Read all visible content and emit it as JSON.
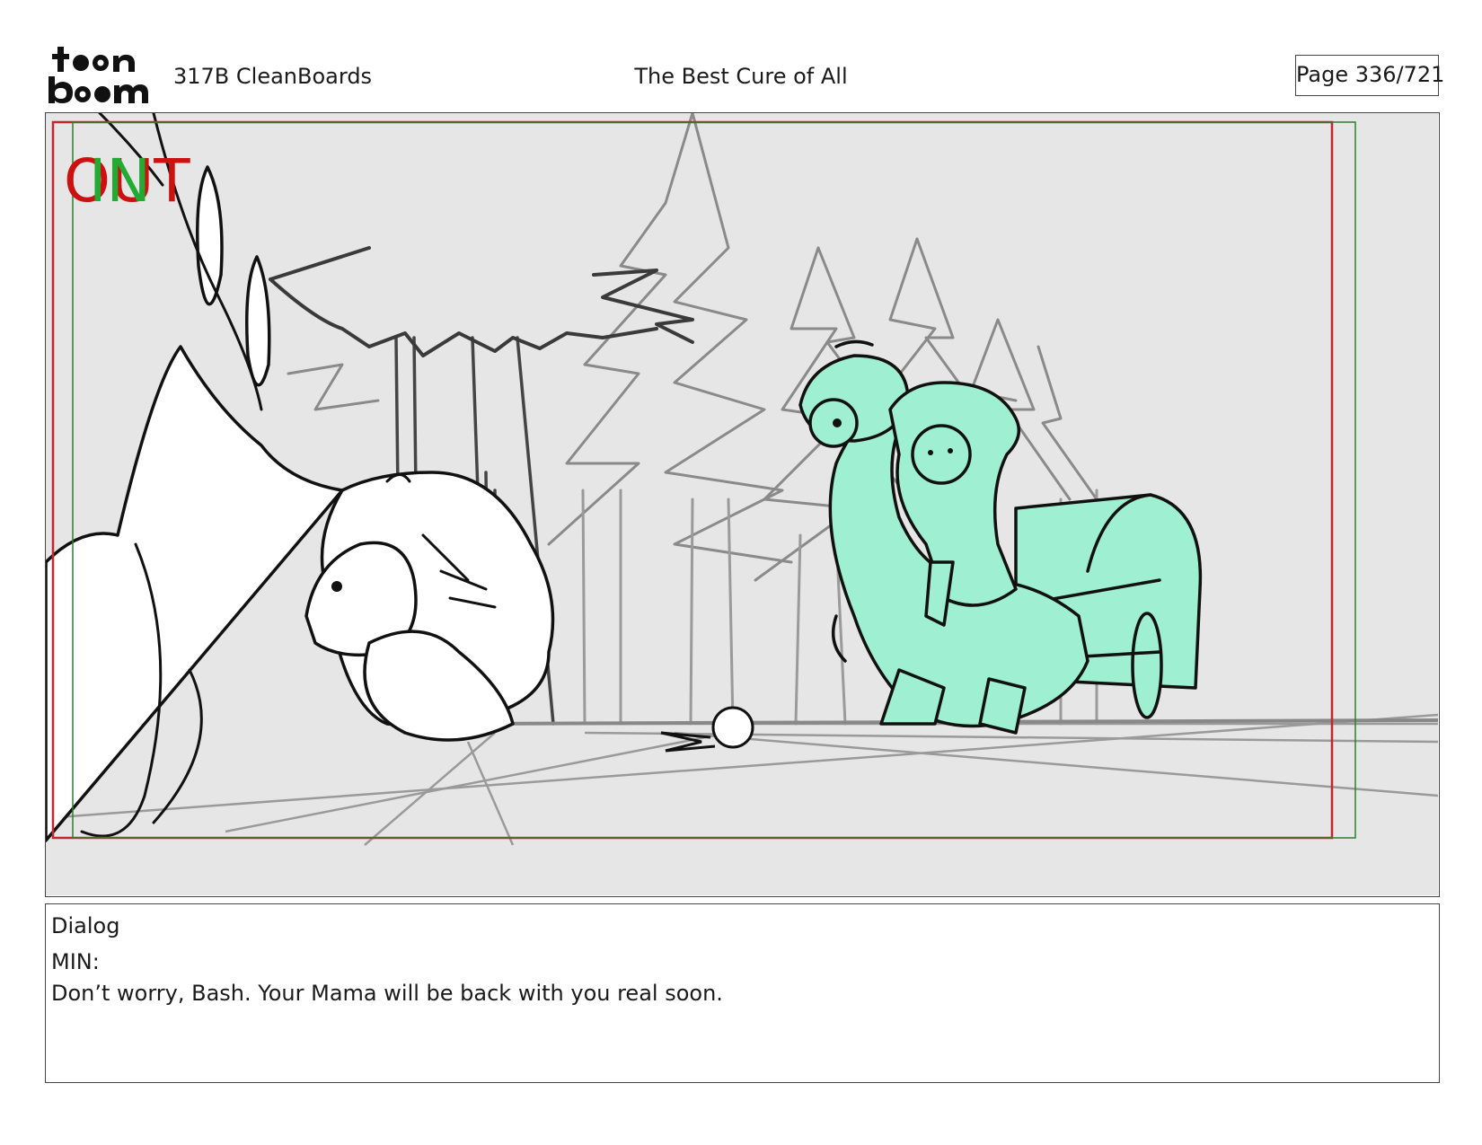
{
  "header": {
    "logo_text": "toon boom",
    "scene": "317B  CleanBoards",
    "title": "The Best Cure of All",
    "page": "Page 336/721"
  },
  "panel": {
    "out_marker": "OUT",
    "in_marker": "IN",
    "colors": {
      "background": "#e6e6e6",
      "safe_frame": "#c1272d",
      "title_frame": "#2e7d32",
      "character_fill": "#9ff0d3",
      "in_marker": "#22aa33",
      "out_marker": "#cc1111"
    }
  },
  "dialog": {
    "label": "Dialog",
    "speaker": "MIN:",
    "line": "Don’t worry, Bash. Your Mama will be back with you real soon."
  }
}
